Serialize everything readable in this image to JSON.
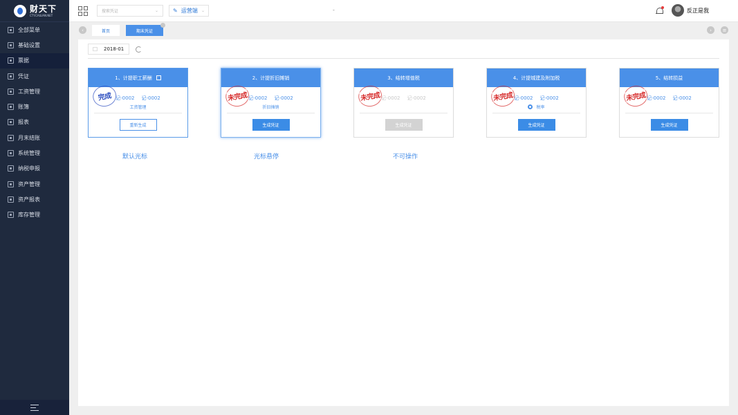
{
  "logo": {
    "main": "财天下",
    "sub": "CTY.CAILIAN.NET"
  },
  "sidebar": {
    "items": [
      {
        "label": "全部菜单",
        "active": false
      },
      {
        "label": "基础设置",
        "active": false
      },
      {
        "label": "票据",
        "active": true
      },
      {
        "label": "凭证",
        "active": false
      },
      {
        "label": "工资管理",
        "active": false
      },
      {
        "label": "账簿",
        "active": false
      },
      {
        "label": "报表",
        "active": false
      },
      {
        "label": "月末结账",
        "active": false
      },
      {
        "label": "系统管理",
        "active": false
      },
      {
        "label": "纳税申报",
        "active": false
      },
      {
        "label": "资产管理",
        "active": false
      },
      {
        "label": "资产报表",
        "active": false
      },
      {
        "label": "库存管理",
        "active": false
      }
    ]
  },
  "header": {
    "search_placeholder": "搜索凭证",
    "ops_label": "运营端",
    "center_mark": "-",
    "username": "反正是我"
  },
  "tabs": [
    {
      "label": "首页"
    },
    {
      "label": "期末凭证"
    }
  ],
  "toolbar": {
    "period": "2018-01"
  },
  "cards": [
    {
      "title": "1、计提职工薪酬",
      "links": [
        "记-0002",
        "记-0002"
      ],
      "sub": "工资管理",
      "stamp": "完成",
      "button": "重新生成"
    },
    {
      "title": "2、计提折旧摊销",
      "links": [
        "记-0002",
        "记-0002"
      ],
      "sub": "折旧摊销",
      "stamp": "未完成",
      "button": "生成凭证"
    },
    {
      "title": "3、结转增值税",
      "links": [
        "记-0002",
        "记-0002"
      ],
      "sub": "",
      "stamp": "未完成",
      "button": "生成凭证"
    },
    {
      "title": "4、计提城建及附加税",
      "links": [
        "记-0002",
        "记-0002"
      ],
      "sub": "税率",
      "stamp": "未完成",
      "button": "生成凭证"
    },
    {
      "title": "5、结转损益",
      "links": [
        "记-0002",
        "记-0002"
      ],
      "sub": "",
      "stamp": "未完成",
      "button": "生成凭证"
    }
  ],
  "captions": [
    "默认光标",
    "光标悬停",
    "不可操作"
  ],
  "colors": {
    "accent": "#4a90e8",
    "sidebar_bg": "#1f2a3e",
    "stamp_red": "#d62b2b",
    "stamp_blue": "#2d4fc0"
  }
}
